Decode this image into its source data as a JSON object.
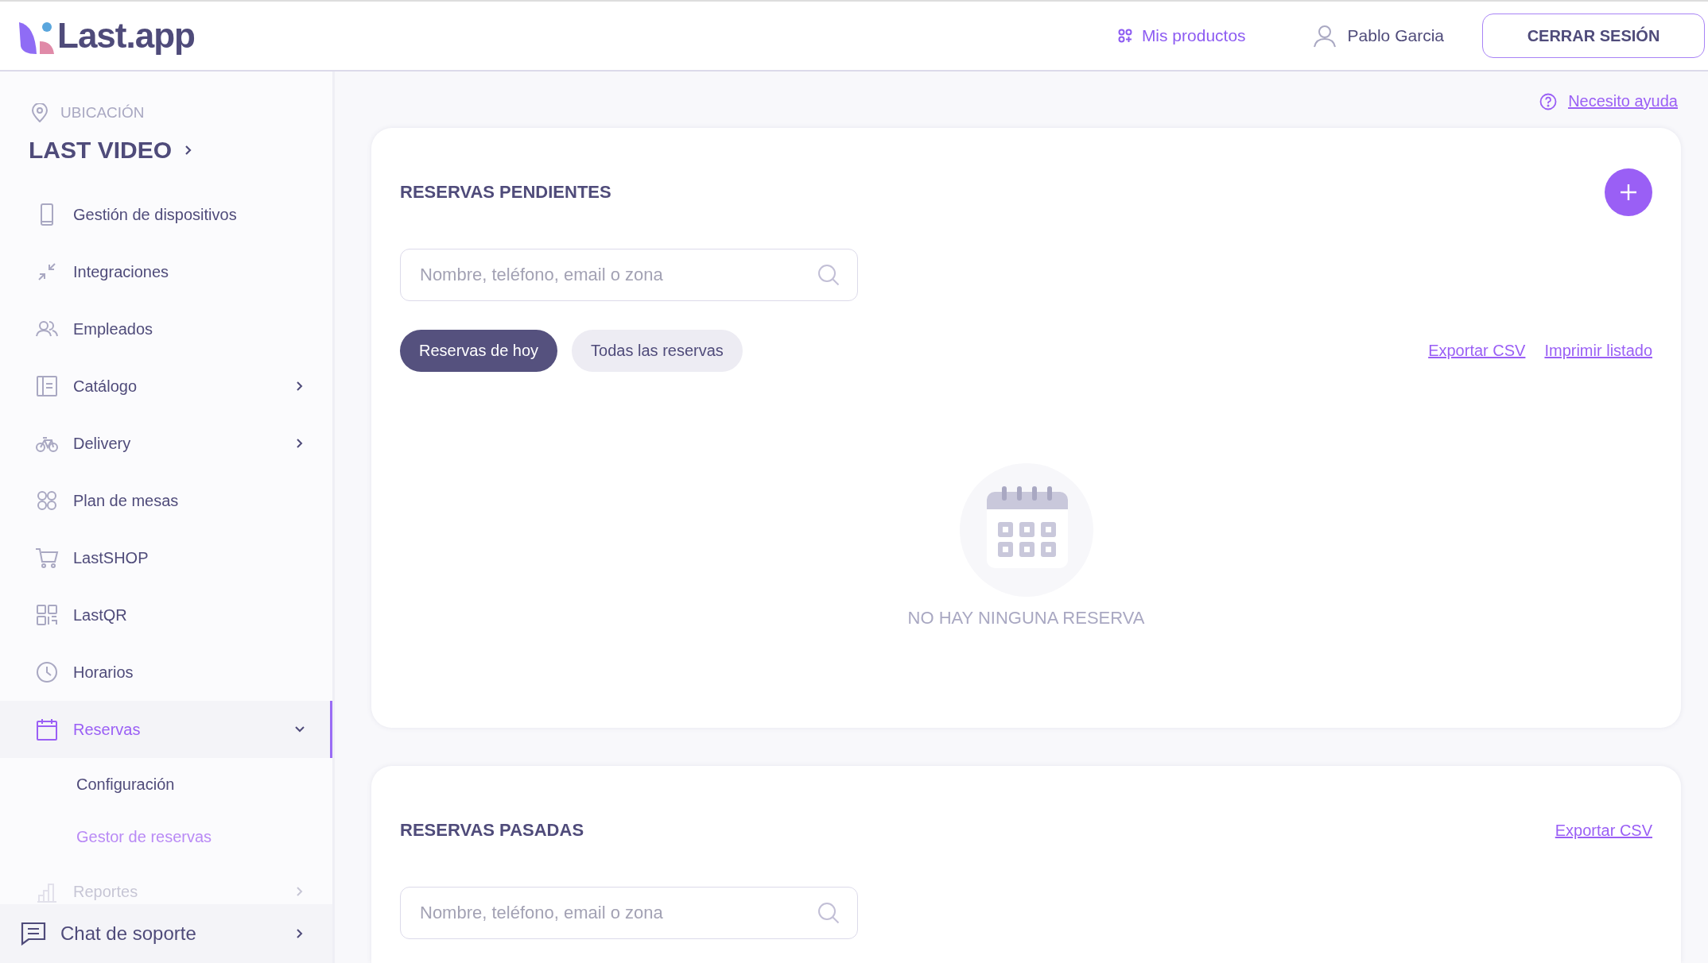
{
  "header": {
    "logo": "Last.app",
    "products_link": "Mis productos",
    "user_name": "Pablo Garcia",
    "logout_button": "CERRAR SESIÓN"
  },
  "sidebar": {
    "location_label": "UBICACIÓN",
    "location_name": "LAST VIDEO",
    "items": [
      {
        "label": "Gestión de dispositivos",
        "selected": false
      },
      {
        "label": "Integraciones",
        "selected": false
      },
      {
        "label": "Empleados",
        "selected": false
      },
      {
        "label": "Catálogo",
        "selected": false,
        "expanded": false
      },
      {
        "label": "Delivery",
        "selected": false,
        "expanded": false
      },
      {
        "label": "Plan de mesas",
        "selected": false
      },
      {
        "label": "LastSHOP",
        "selected": false
      },
      {
        "label": "LastQR",
        "selected": false
      },
      {
        "label": "Horarios",
        "selected": false
      },
      {
        "label": "Reservas",
        "selected": true,
        "expanded": true,
        "children": [
          {
            "label": "Configuración",
            "selected": false
          },
          {
            "label": "Gestor de reservas",
            "selected": true
          }
        ]
      },
      {
        "label": "Reportes",
        "selected": false,
        "expanded": false,
        "faded": true
      }
    ],
    "support": "Chat de soporte"
  },
  "help_link": "Necesito ayuda",
  "pending": {
    "title": "RESERVAS PENDIENTES",
    "search": {
      "placeholder": "Nombre, teléfono, email o zona"
    },
    "filters": [
      {
        "label": "Reservas de hoy",
        "selected": true
      },
      {
        "label": "Todas las reservas",
        "selected": false
      }
    ],
    "links": [
      "Exportar CSV",
      "Imprimir listado"
    ],
    "empty_message": "NO HAY NINGUNA RESERVA"
  },
  "past": {
    "title": "RESERVAS PASADAS",
    "links": [
      "Exportar CSV"
    ],
    "search": {
      "placeholder": "Nombre, teléfono, email o zona"
    }
  }
}
